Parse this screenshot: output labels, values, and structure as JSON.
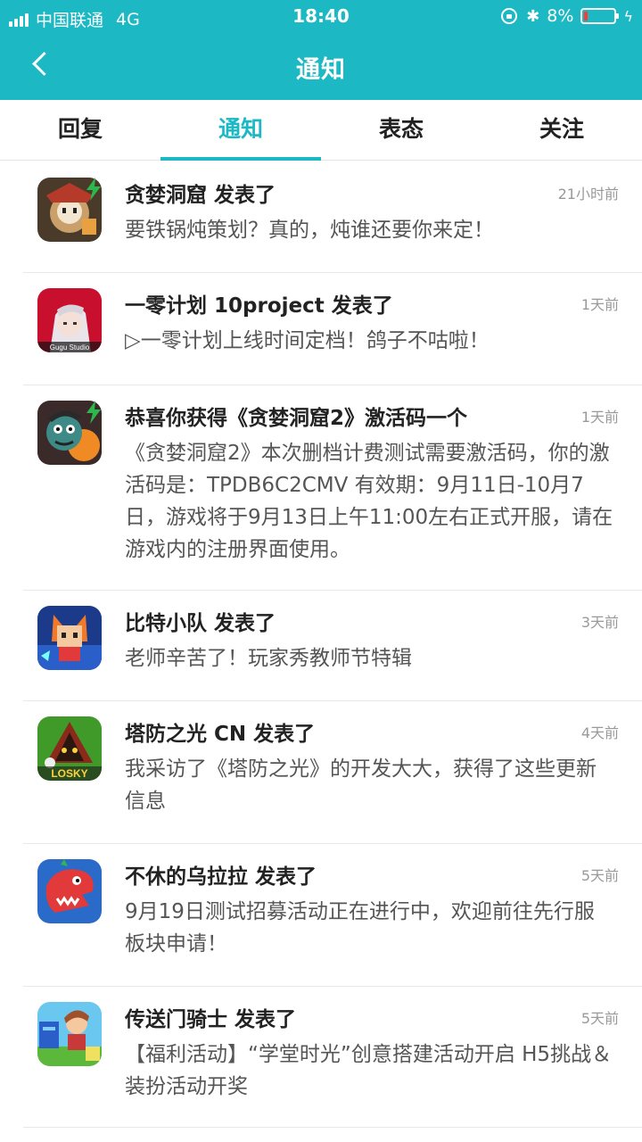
{
  "status_bar": {
    "carrier": "中国联通",
    "network": "4G",
    "time": "18:40",
    "battery": "8%"
  },
  "header": {
    "title": "通知"
  },
  "tabs": [
    {
      "label": "回复",
      "active": false
    },
    {
      "label": "通知",
      "active": true
    },
    {
      "label": "表态",
      "active": false
    },
    {
      "label": "关注",
      "active": false
    }
  ],
  "notifications": [
    {
      "title": "贪婪洞窟 发表了",
      "time": "21小时前",
      "text": "要铁锅炖策划？真的，炖谁还要你来定！",
      "icon": "cave-game-icon"
    },
    {
      "title": "一零计划 10project 发表了",
      "time": "1天前",
      "text": "▷一零计划上线时间定档！鸽子不咕啦！",
      "icon": "project-game-icon",
      "icon_caption": "Gugu Studio"
    },
    {
      "title": "恭喜你获得《贪婪洞窟2》激活码一个",
      "time": "1天前",
      "text": "《贪婪洞窟2》本次删档计费测试需要激活码，你的激活码是：TPDB6C2CMV 有效期：9月11日-10月7日，游戏将于9月13日上午11:00左右正式开服，请在游戏内的注册界面使用。",
      "icon": "cave2-game-icon"
    },
    {
      "title": "比特小队 发表了",
      "time": "3天前",
      "text": "老师辛苦了！玩家秀教师节特辑",
      "icon": "bit-squad-game-icon"
    },
    {
      "title": "塔防之光 CN 发表了",
      "time": "4天前",
      "text": "我采访了《塔防之光》的开发大大，获得了这些更新信息",
      "icon": "tower-defense-game-icon",
      "icon_caption": "LOSKY"
    },
    {
      "title": "不休的乌拉拉 发表了",
      "time": "5天前",
      "text": "9月19日测试招募活动正在进行中，欢迎前往先行服板块申请！",
      "icon": "dino-game-icon"
    },
    {
      "title": "传送门骑士 发表了",
      "time": "5天前",
      "text": "【福利活动】“学堂时光”创意搭建活动开启 H5挑战＆装扮活动开奖",
      "icon": "portal-knights-game-icon"
    }
  ]
}
